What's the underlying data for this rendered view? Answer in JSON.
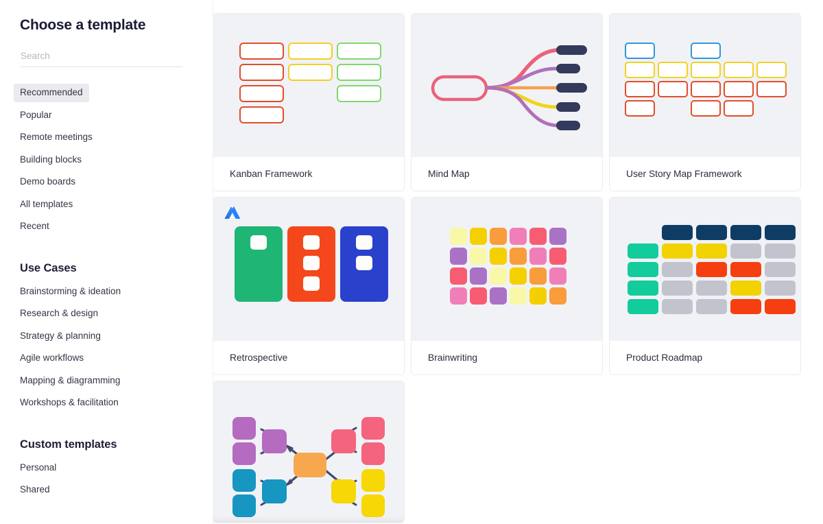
{
  "sidebar": {
    "title": "Choose a template",
    "search": {
      "placeholder": "Search",
      "value": ""
    },
    "nav_items": [
      {
        "label": "Recommended",
        "active": true
      },
      {
        "label": "Popular",
        "active": false
      },
      {
        "label": "Remote meetings",
        "active": false
      },
      {
        "label": "Building blocks",
        "active": false
      },
      {
        "label": "Demo boards",
        "active": false
      },
      {
        "label": "All templates",
        "active": false
      },
      {
        "label": "Recent",
        "active": false
      }
    ],
    "use_cases_heading": "Use Cases",
    "use_cases": [
      {
        "label": "Brainstorming & ideation"
      },
      {
        "label": "Research & design"
      },
      {
        "label": "Strategy & planning"
      },
      {
        "label": "Agile workflows"
      },
      {
        "label": "Mapping & diagramming"
      },
      {
        "label": "Workshops & facilitation"
      }
    ],
    "custom_heading": "Custom templates",
    "custom_items": [
      {
        "label": "Personal"
      },
      {
        "label": "Shared"
      }
    ]
  },
  "templates": [
    {
      "name": "Kanban Framework",
      "thumb": "kanban"
    },
    {
      "name": "Mind Map",
      "thumb": "mindmap"
    },
    {
      "name": "User Story Map Framework",
      "thumb": "userstorymap"
    },
    {
      "name": "Retrospective",
      "thumb": "retrospective",
      "badge": "atlassian-logo"
    },
    {
      "name": "Brainwriting",
      "thumb": "brainwriting"
    },
    {
      "name": "Product Roadmap",
      "thumb": "productroadmap"
    }
  ],
  "partial_card": {
    "thumb": "concept-map-diagram"
  },
  "colors": {
    "thumb_bg": "#f1f2f6",
    "card_bg": "#ffffff",
    "text_primary": "#191a33",
    "text_body": "#343446",
    "active_nav_bg": "#ebebef",
    "kanban_red": "#e04e2a",
    "kanban_yellow": "#f2cf22",
    "kanban_green": "#7fd96a",
    "mindmap_rose": "#e8637a",
    "mindmap_purple": "#b070bd",
    "mindmap_orange": "#f5a04f",
    "mindmap_yellow": "#f2d417",
    "mindmap_navy": "#333a5c",
    "usm_blue": "#2f96dd",
    "usm_yellow": "#f3d222",
    "usm_red": "#e04e2a",
    "retro_green": "#1fb574",
    "retro_red": "#f4471c",
    "retro_blue": "#2a41cc",
    "bw_pale": "#f9f7a8",
    "bw_gold": "#f5d000",
    "bw_orange": "#f99c3c",
    "bw_pink": "#f07fb8",
    "bw_rose": "#f85c72",
    "bw_purple": "#a972c4",
    "pr_navy": "#0f3c64",
    "pr_teal": "#12cc9b",
    "pr_yellow": "#f2d200",
    "pr_gray": "#c3c3ce",
    "pr_red": "#f53f10",
    "dg_orange": "#f7a84e",
    "dg_purple": "#b46bc0",
    "dg_blue": "#1696c0",
    "dg_pink": "#f4647e",
    "dg_yellow": "#f7d706",
    "dg_arrow": "#414a6b",
    "atlassian_blue": "#2681ff"
  }
}
